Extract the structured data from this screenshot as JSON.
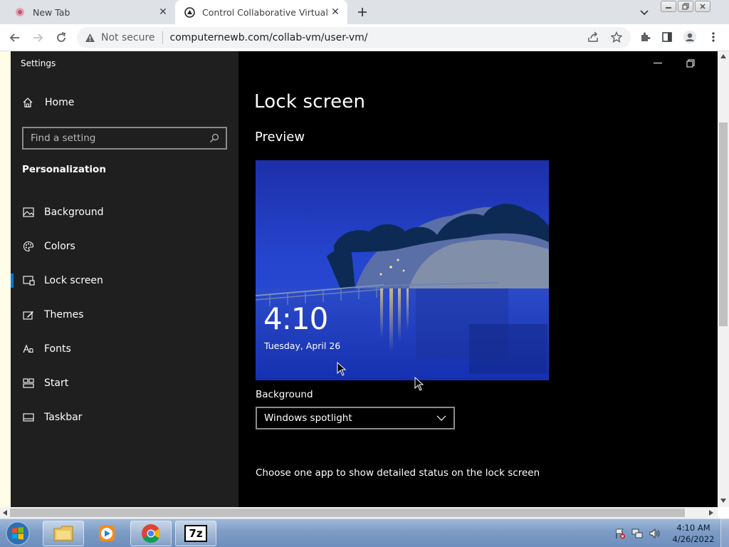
{
  "browser": {
    "tabs": [
      {
        "title": "New Tab",
        "active": false
      },
      {
        "title": "Control Collaborative Virtual Ma",
        "active": true
      }
    ],
    "address": {
      "security_label": "Not secure",
      "url": "computernewb.com/collab-vm/user-vm/"
    }
  },
  "settings": {
    "app_title": "Settings",
    "home_label": "Home",
    "search_placeholder": "Find a setting",
    "section": "Personalization",
    "nav": [
      {
        "label": "Background",
        "icon": "picture-icon"
      },
      {
        "label": "Colors",
        "icon": "palette-icon"
      },
      {
        "label": "Lock screen",
        "icon": "lock-screen-icon",
        "selected": true
      },
      {
        "label": "Themes",
        "icon": "themes-icon"
      },
      {
        "label": "Fonts",
        "icon": "fonts-icon"
      },
      {
        "label": "Start",
        "icon": "start-icon"
      },
      {
        "label": "Taskbar",
        "icon": "taskbar-icon"
      }
    ],
    "accent_color": "#0078d7"
  },
  "content": {
    "title": "Lock screen",
    "preview_label": "Preview",
    "preview_time": "4:10",
    "preview_date": "Tuesday, April 26",
    "background_label": "Background",
    "background_value": "Windows spotlight",
    "status_label": "Choose one app to show detailed status on the lock screen"
  },
  "taskbar": {
    "time": "4:10 AM",
    "date": "4/26/2022",
    "apps": [
      "file-explorer-icon",
      "media-player-icon",
      "chrome-icon",
      "7zip-icon"
    ],
    "sevenzip_label": "7z"
  }
}
